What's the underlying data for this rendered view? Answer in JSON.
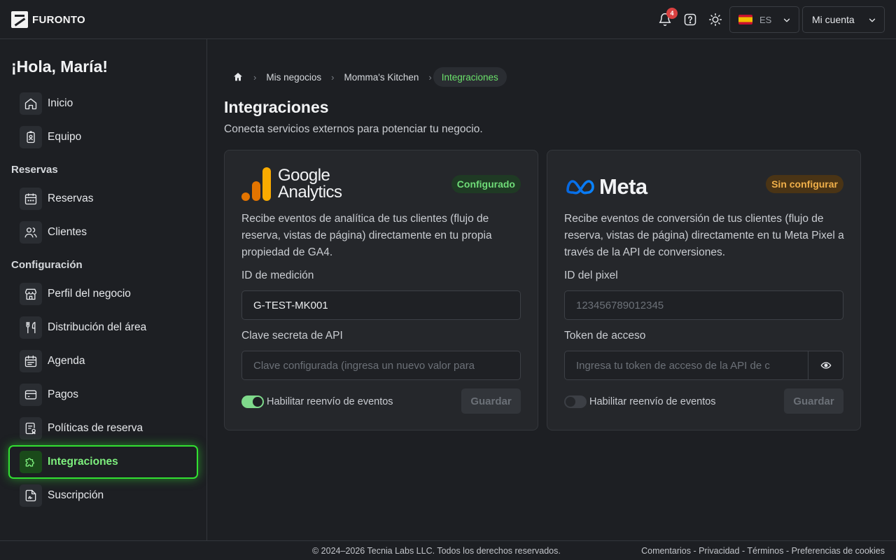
{
  "topbar": {
    "brand": "FURONTO",
    "notifications_count": "4",
    "language": "ES",
    "account_label": "Mi cuenta"
  },
  "sidebar": {
    "greeting": "¡Hola, María!",
    "items": [
      {
        "label": "Inicio",
        "icon": "home-icon"
      },
      {
        "label": "Equipo",
        "icon": "id-badge-icon"
      },
      {
        "label": "Reservas",
        "icon": "calendar-icon"
      },
      {
        "label": "Clientes",
        "icon": "users-icon"
      },
      {
        "label": "Perfil del negocio",
        "icon": "store-icon"
      },
      {
        "label": "Distribución del área",
        "icon": "utensils-icon"
      },
      {
        "label": "Agenda",
        "icon": "calendar-list-icon"
      },
      {
        "label": "Pagos",
        "icon": "credit-card-icon"
      },
      {
        "label": "Políticas de reserva",
        "icon": "policy-document-icon"
      },
      {
        "label": "Integraciones",
        "icon": "puzzle-icon",
        "active": true
      },
      {
        "label": "Suscripción",
        "icon": "signature-icon"
      }
    ],
    "sections": [
      "Reservas",
      "Configuración"
    ]
  },
  "breadcrumb": [
    "Mis negocios",
    "Momma's Kitchen",
    "Integraciones"
  ],
  "page": {
    "title": "Integraciones",
    "subtitle": "Conecta servicios externos para potenciar tu negocio."
  },
  "cards": [
    {
      "brand_line1": "Google",
      "brand_line2": "Analytics",
      "status": "Configurado",
      "description": "Recibe eventos de analítica de tus clientes (flujo de reserva, vistas de página) directamente en tu propia propiedad de GA4.",
      "field1_label": "ID de medición",
      "field1_value": "G-TEST-MK001",
      "field2_label": "Clave secreta de API",
      "field2_placeholder": "Clave configurada (ingresa un nuevo valor para",
      "toggle_label": "Habilitar reenvío de eventos",
      "toggle_on": true,
      "save_label": "Guardar"
    },
    {
      "brand": "Meta",
      "status": "Sin configurar",
      "description": "Recibe eventos de conversión de tus clientes (flujo de reserva, vistas de página) directamente en tu Meta Pixel a través de la API de conversiones.",
      "field1_label": "ID del pixel",
      "field1_placeholder": "123456789012345",
      "field2_label": "Token de acceso",
      "field2_placeholder": "Ingresa tu token de acceso de la API de c",
      "toggle_label": "Habilitar reenvío de eventos",
      "toggle_on": false,
      "save_label": "Guardar"
    }
  ],
  "footer": {
    "copyright": "© 2024–2026 Tecnia Labs LLC. Todos los derechos reservados.",
    "links": [
      "Comentarios",
      "Privacidad",
      "Términos",
      "Preferencias de cookies"
    ]
  },
  "colors": {
    "accent_green": "#32e032",
    "configured_badge": "#6fdc78",
    "unconfigured_badge": "#f1b04a",
    "notification_badge": "#d94141"
  }
}
